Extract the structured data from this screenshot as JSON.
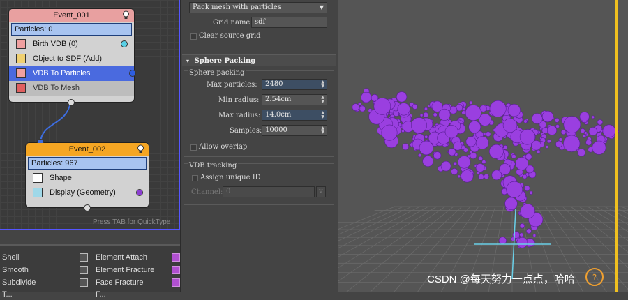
{
  "particle_view": {
    "event1": {
      "title": "Event_001",
      "count": "Particles: 0",
      "ops": [
        "Birth VDB (0)",
        "Object to SDF (Add)",
        "VDB To Particles",
        "VDB To Mesh"
      ]
    },
    "event2": {
      "title": "Event_002",
      "count": "Particles: 967",
      "ops": [
        "Shape",
        "Display (Geometry)"
      ]
    },
    "hint": "Press TAB for QuickType"
  },
  "operator_list": {
    "col1": [
      "Shell",
      "Smooth",
      "Subdivide",
      "T..."
    ],
    "col2": [
      "Element Attach",
      "Element Fracture",
      "Face Fracture",
      "F..."
    ]
  },
  "panel": {
    "mode_dropdown": "Pack mesh with particles",
    "grid_name_label": "Grid name:",
    "grid_name_value": "sdf",
    "clear_source_grid": "Clear source grid",
    "sphere_packing": {
      "title": "Sphere Packing",
      "group": "Sphere packing",
      "max_particles_label": "Max particles:",
      "max_particles": "2480",
      "min_radius_label": "Min radius:",
      "min_radius": "2.54cm",
      "max_radius_label": "Max radius:",
      "max_radius": "14.0cm",
      "samples_label": "Samples:",
      "samples": "10000",
      "allow_overlap": "Allow overlap"
    },
    "vdb_tracking": {
      "group": "VDB tracking",
      "assign_unique_id": "Assign unique ID",
      "channel_label": "Channel:",
      "channel_value": "0"
    }
  },
  "viewport": {
    "watermark": "CSDN @每天努力一点点，哈哈",
    "sphere_color": "#9a3fe0"
  },
  "colors": {
    "event1_header": "#e8a0a0",
    "event2_header": "#f5a623",
    "selection": "#4a6adf",
    "frame": "#f0c020"
  }
}
